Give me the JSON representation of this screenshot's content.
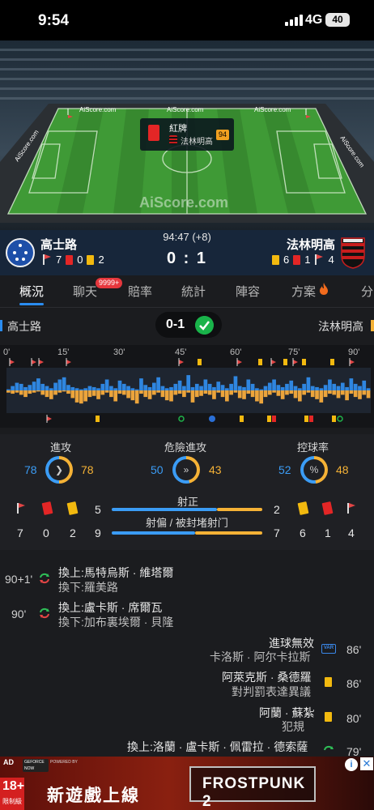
{
  "status": {
    "time": "9:54",
    "network": "4G",
    "battery": "40"
  },
  "pitch": {
    "ads": [
      "AiScore.com",
      "AiScore.com",
      "AiScore.com",
      "AiScore.com",
      "AiScore.com"
    ],
    "watermark": "AiScore.com",
    "event_popup": {
      "label": "紅牌",
      "team": "法林明高",
      "minute": "94"
    }
  },
  "match": {
    "home": {
      "name": "高士路",
      "corners": "7",
      "red": "0",
      "yellow": "2"
    },
    "away": {
      "name": "法林明高",
      "yellow": "6",
      "red": "1",
      "corners": "4"
    },
    "clock": "94:47 (+8)",
    "score": "0 : 1",
    "score_short": "0-1"
  },
  "tabs": [
    "概況",
    "聊天",
    "賠率",
    "統計",
    "陣容",
    "方案",
    "分"
  ],
  "chat_badge": "9999+",
  "timeline": {
    "ticks": [
      "0'",
      "15'",
      "30'",
      "45'",
      "60'",
      "75'",
      "90'"
    ],
    "home_pressure": [
      0.05,
      0.2,
      0.35,
      0.3,
      0.15,
      0.25,
      0.4,
      0.55,
      0.3,
      0.2,
      0.1,
      0.35,
      0.5,
      0.6,
      0.25,
      0.15,
      0.1,
      0.05,
      0.1,
      0.2,
      0.15,
      0.1,
      0.3,
      0.5,
      0.2,
      0.1,
      0.45,
      0.3,
      0.2,
      0.1,
      0.05,
      0.55,
      0.25,
      0.15,
      0.35,
      0.6,
      0.2,
      0.1,
      0.15,
      0.3,
      0.45,
      0.2,
      0.7,
      0.15,
      0.3,
      0.2,
      0.5,
      0.3,
      0.15,
      0.4,
      0.25,
      0.1,
      0.3,
      0.65,
      0.2,
      0.15,
      0.5,
      0.3,
      0.1,
      0.05,
      0.2,
      0.35,
      0.5,
      0.25,
      0.15,
      0.3,
      0.45,
      0.2,
      0.1,
      0.3,
      0.6,
      0.2,
      0.15,
      0.1,
      0.25,
      0.5,
      0.3,
      0.2,
      0.35,
      0.15,
      0.55,
      0.3,
      0.2,
      0.45,
      0.1
    ],
    "away_pressure": [
      0.1,
      0.15,
      0.1,
      0.2,
      0.3,
      0.15,
      0.1,
      0.05,
      0.2,
      0.3,
      0.4,
      0.2,
      0.1,
      0.05,
      0.15,
      0.35,
      0.55,
      0.6,
      0.5,
      0.3,
      0.25,
      0.4,
      0.2,
      0.1,
      0.3,
      0.5,
      0.15,
      0.2,
      0.35,
      0.45,
      0.6,
      0.15,
      0.3,
      0.4,
      0.2,
      0.1,
      0.3,
      0.45,
      0.5,
      0.2,
      0.15,
      0.3,
      0.1,
      0.55,
      0.3,
      0.25,
      0.15,
      0.2,
      0.4,
      0.1,
      0.3,
      0.5,
      0.2,
      0.1,
      0.35,
      0.4,
      0.15,
      0.3,
      0.5,
      0.6,
      0.3,
      0.2,
      0.1,
      0.25,
      0.4,
      0.2,
      0.15,
      0.35,
      0.5,
      0.2,
      0.1,
      0.3,
      0.4,
      0.55,
      0.3,
      0.15,
      0.2,
      0.35,
      0.2,
      0.45,
      0.15,
      0.3,
      0.4,
      0.2,
      0.35
    ]
  },
  "stats": {
    "attack": {
      "label": "進攻",
      "home": "78",
      "away": "78"
    },
    "danger": {
      "label": "危險進攻",
      "home": "50",
      "away": "43"
    },
    "possession": {
      "label": "控球率",
      "home": "52",
      "away": "48",
      "symbol": "%"
    },
    "on_target": {
      "label": "射正",
      "home": "5",
      "away": "2"
    },
    "off_target": {
      "label": "射偏 / 被封堵射门",
      "home": "9",
      "away": "7"
    },
    "home_counts": {
      "corners": "7",
      "red": "0",
      "yellow": "2"
    },
    "away_counts": {
      "yellow": "6",
      "red": "1",
      "corners": "4"
    }
  },
  "events": [
    {
      "minute": "90+1'",
      "in": "換上:馬特烏斯 · 維塔爾",
      "out": "換下:羅美路"
    },
    {
      "minute": "90'",
      "in": "換上:盧卡斯 · 席爾瓦",
      "out": "換下:加布裏埃爾 · 貝隆"
    },
    {
      "minute": "86'",
      "title": "進球無效",
      "detail": "卡洛斯 · 阿尔卡拉斯",
      "icon": "VAR"
    },
    {
      "minute": "86'",
      "title": "阿萊克斯 · 桑德羅",
      "detail": "對判罰表達異議"
    },
    {
      "minute": "80'",
      "title": "阿蘭 · 蘇紮",
      "detail": "犯規"
    },
    {
      "minute": "79'",
      "title": "換上:洛蘭 · 盧卡斯 · 佩雷拉 · 德索薩"
    }
  ],
  "ad": {
    "label": "AD",
    "brand": "GEFORCE NOW",
    "rating": "18+",
    "rating_sub": "限制級",
    "headline": "新遊戲上線",
    "game": "FROSTPUNK 2",
    "powered": "POWERED BY"
  }
}
